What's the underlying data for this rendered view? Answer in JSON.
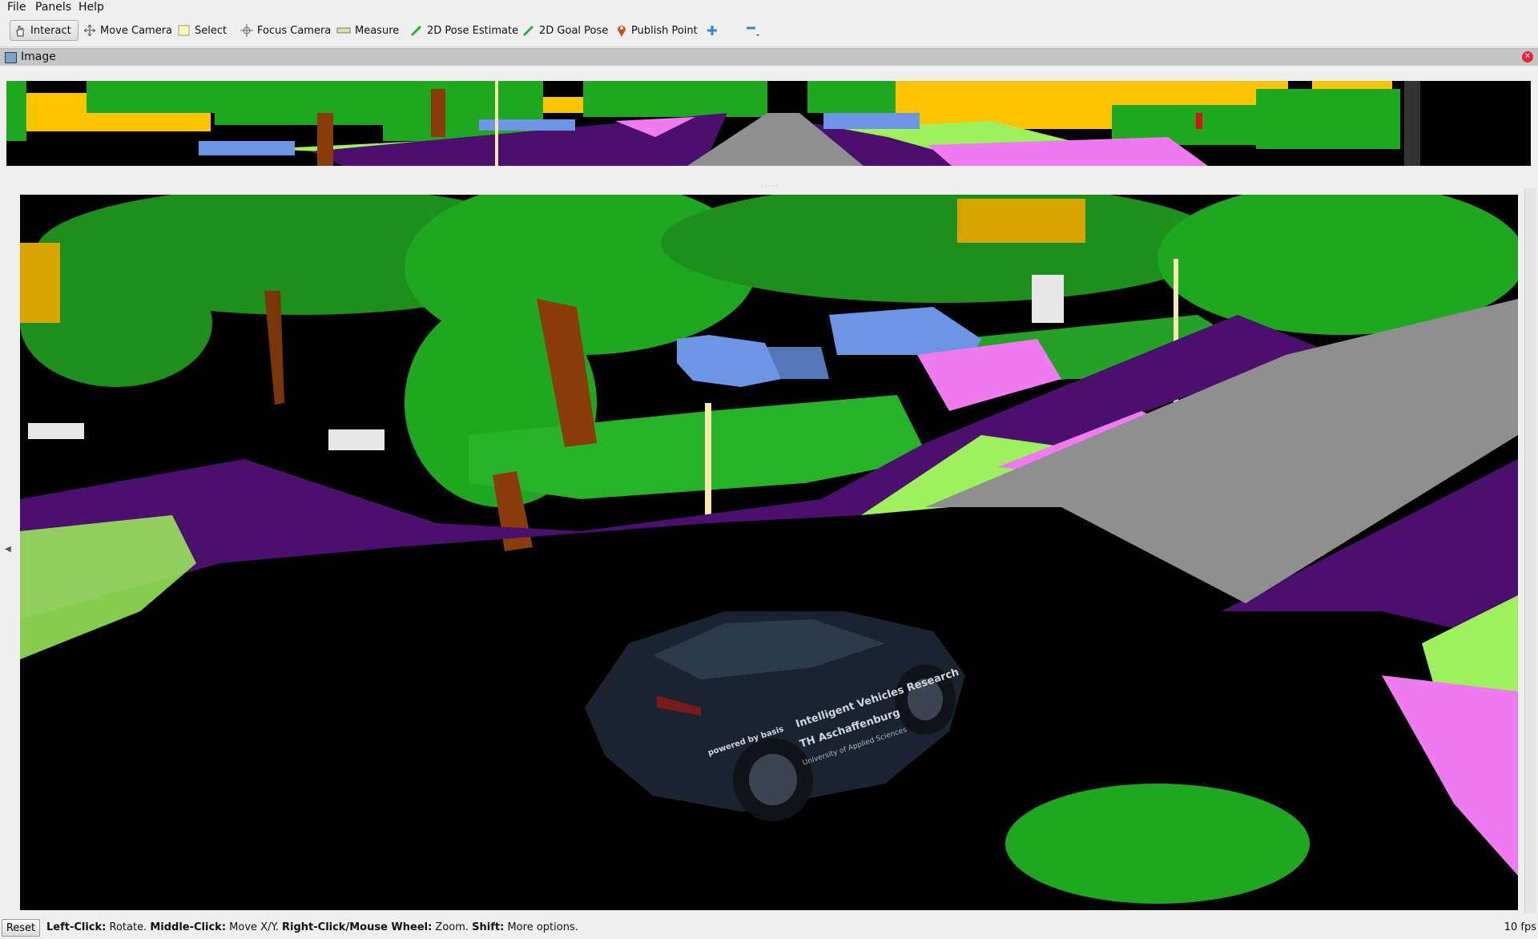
{
  "menu": {
    "items": [
      "File",
      "Panels",
      "Help"
    ]
  },
  "toolbar": {
    "interact": "Interact",
    "move_camera": "Move Camera",
    "select": "Select",
    "focus_camera": "Focus Camera",
    "measure": "Measure",
    "pose_estimate": "2D Pose Estimate",
    "goal_pose": "2D Goal Pose",
    "publish_point": "Publish Point",
    "add_icon": "plus-icon",
    "remove_icon": "minus-icon"
  },
  "panel": {
    "title": "Image"
  },
  "vehicle": {
    "line1": "Intelligent Vehicles Research",
    "line2": "TH Aschaffenburg",
    "line3": "University of Applied Sciences",
    "brand": "powered by basis"
  },
  "status": {
    "reset": "Reset",
    "left_click": "Left-Click:",
    "left_click_desc": " Rotate. ",
    "middle_click": "Middle-Click:",
    "middle_click_desc": " Move X/Y. ",
    "right_click": "Right-Click/Mouse Wheel:",
    "right_click_desc": " Zoom. ",
    "shift": "Shift:",
    "shift_desc": " More options.",
    "fps": "10 fps"
  },
  "colors": {
    "vegetation": "#1fa81f",
    "terrain": "#9ef05c",
    "sidewalk": "#4b0f6e",
    "road": "#8f8f8f",
    "building": "#ffc400",
    "car": "#6c95e6",
    "trunk": "#8a3d0a",
    "bike_path": "#f07af0"
  }
}
